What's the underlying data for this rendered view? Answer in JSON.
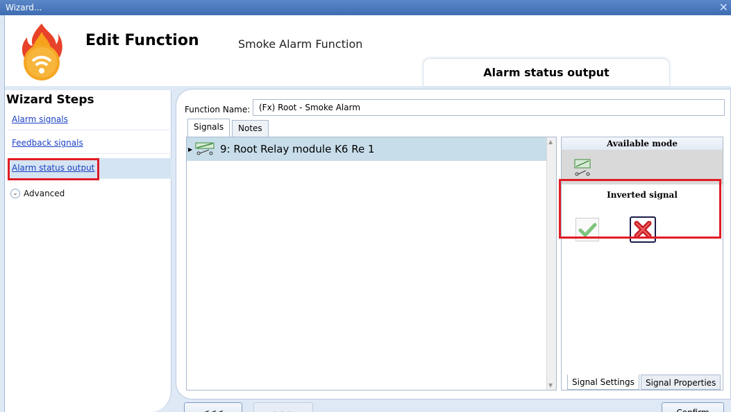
{
  "window": {
    "title": "Wizard...",
    "close_glyph": "✕"
  },
  "header": {
    "title": "Edit Function",
    "subtitle": "Smoke Alarm Function",
    "section_tab": "Alarm status output"
  },
  "wizard": {
    "title": "Wizard Steps",
    "steps": [
      {
        "label": "Alarm signals"
      },
      {
        "label": "Feedback signals"
      },
      {
        "label": "Alarm status output"
      }
    ],
    "advanced_label": "Advanced"
  },
  "form": {
    "function_name_label": "Function Name:",
    "function_name_value": "(Fx) Root - Smoke Alarm",
    "tabs": [
      "Signals",
      "Notes"
    ]
  },
  "signals": [
    {
      "label": "9: Root Relay module K6 Re 1"
    }
  ],
  "settings": {
    "available_mode_title": "Available mode",
    "inverted_signal_title": "Inverted signal",
    "tabs": [
      "Signal Settings",
      "Signal Properties"
    ]
  },
  "nav": {
    "back_label": "<<<",
    "next_label": ">>>",
    "confirm_label": "Confirm"
  },
  "icons": {
    "logo": "fire-wireless-icon",
    "mode": "relay-switch-icon",
    "check": "green-check-icon",
    "cross": "red-x-icon"
  },
  "colors": {
    "highlight": "#e01b24",
    "link": "#1a3ec4",
    "selection": "#c7dde9"
  }
}
